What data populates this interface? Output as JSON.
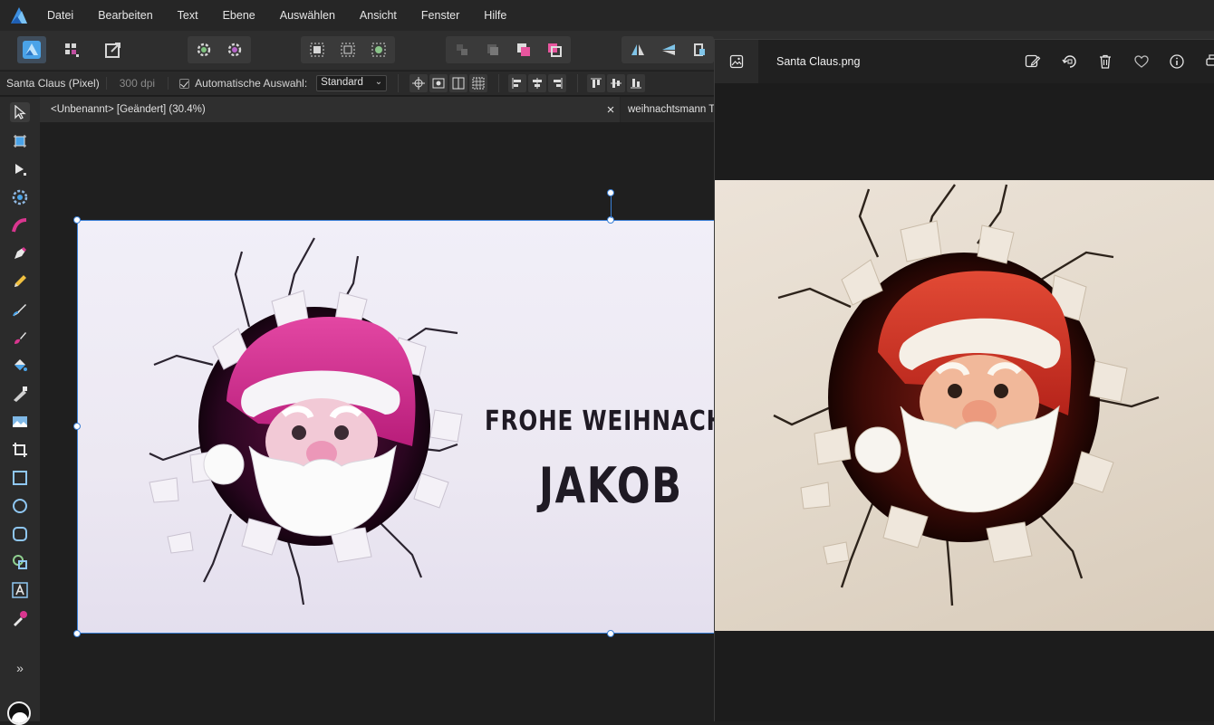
{
  "menubar": {
    "items": [
      "Datei",
      "Bearbeiten",
      "Text",
      "Ebene",
      "Auswählen",
      "Ansicht",
      "Fenster",
      "Hilfe"
    ]
  },
  "contextbar": {
    "doc_info": "Santa Claus (Pixel)",
    "dpi": "300 dpi",
    "auto_select_label": "Automatische Auswahl:",
    "auto_select_value": "Standard"
  },
  "doc_tabs": [
    {
      "label": "<Unbenannt> [Geändert] (30.4%)",
      "close": "×"
    },
    {
      "label": "weihnachtsmann Ta"
    }
  ],
  "artboard": {
    "line1": "Frohe Weihnachte",
    "line2": "Jakob"
  },
  "tools_more": "»",
  "viewer": {
    "title": "Santa Claus.png"
  },
  "colors": {
    "accent": "#3a7fd5",
    "affinity_blue": "#4aa3e8",
    "pink_hat": "#d62e8f",
    "red_hat": "#d9352a"
  }
}
